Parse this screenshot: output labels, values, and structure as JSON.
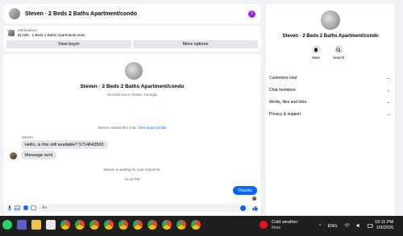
{
  "header": {
    "title": "Steven · 2 Beds 2 Baths Apartment/condo",
    "info_icon": "info-icon"
  },
  "listing": {
    "source": "Marketplace",
    "summary": "$1,000 · 2 Beds 2 Baths Apartment/condo",
    "view_buyer": "View buyer",
    "more_options": "More options"
  },
  "chat": {
    "title": "Steven · 2 Beds 2 Baths Apartment/condo",
    "subtitle": "You both live in Rome, Georgia.",
    "started": "Steven started this chat.",
    "view_profile": "View buyer profile",
    "sender": "Steven",
    "messages": [
      "Hello, is this still available? 5714643565",
      "Message sent"
    ],
    "waiting": "Steven is waiting for your response.",
    "time": "10:11 PM",
    "my_message": "Thanks",
    "composer_placeholder": "Aa"
  },
  "right": {
    "title": "Steven · 2 Beds 2 Baths Apartment/condo",
    "mute": "Mute",
    "search": "Search",
    "menu": [
      "Customize chat",
      "Chat members",
      "Media, files and links",
      "Privacy & support"
    ]
  },
  "taskbar": {
    "weather_title": "Cold weather",
    "weather_sub": "Now",
    "lang": "ENG",
    "time": "10:11 PM",
    "date": "1/9/2026"
  },
  "colors": {
    "accent": "#0866ff",
    "info": "#a020f0",
    "taskbar": "#1f1f1f"
  }
}
